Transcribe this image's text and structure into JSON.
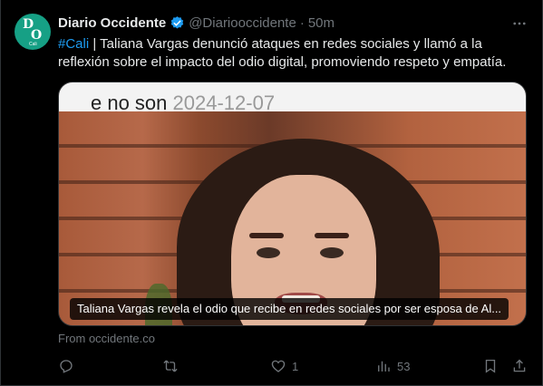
{
  "author": {
    "name": "Diario Occidente",
    "handle": "@Diariooccidente",
    "separator": "·",
    "time": "50m",
    "avatar": {
      "letter_1": "D",
      "letter_2": "O",
      "sub": "Cali",
      "color": "#16a085"
    },
    "verified_color": "#1d9bf0"
  },
  "tweet": {
    "hashtag": "#Cali",
    "body": " | Taliana Vargas denunció ataques en redes sociales y llamó a la reflexión sobre el impacto del odio digital, promoviendo respeto y empatía."
  },
  "media": {
    "overlay_text": "e no son",
    "overlay_date": "2024-12-07",
    "caption": "Taliana Vargas revela el odio que recibe en redes sociales por ser esposa de Al..."
  },
  "source": "From occidente.co",
  "actions": {
    "reply_count": "",
    "retweet_count": "",
    "like_count": "1",
    "views_count": "53"
  },
  "colors": {
    "accent": "#1d9bf0",
    "muted": "#71767b",
    "text": "#e7e9ea",
    "background": "#000000"
  }
}
